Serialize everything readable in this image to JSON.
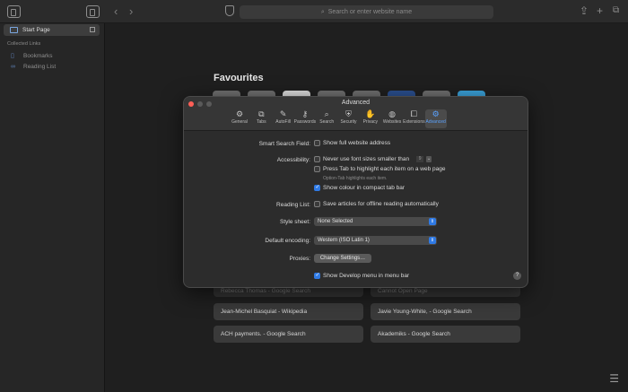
{
  "browser": {
    "address_placeholder": "Search or enter website name",
    "sidebar": {
      "start_page": "Start Page",
      "section": "Collected Links",
      "items": [
        {
          "label": "Bookmarks",
          "icon": "book-icon"
        },
        {
          "label": "Reading List",
          "icon": "glasses-icon"
        }
      ]
    }
  },
  "start_page": {
    "favourites_title": "Favourites",
    "tile_colors": [
      "#6e6e6e",
      "#6e6e6e",
      "#d9d9d9",
      "#6e6e6e",
      "#6e6e6e",
      "#2a4f8f",
      "#6e6e6e",
      "#3aa0d8"
    ],
    "cards": [
      {
        "label": "Rebecca Thomas - Google Search",
        "dim": true
      },
      {
        "label": "Cannot Open Page",
        "dim": true
      },
      {
        "label": "Jean-Michel Basquiat - Wikipedia",
        "dim": false
      },
      {
        "label": "Javie Young-White, - Google Search",
        "dim": false
      },
      {
        "label": "ACH payments. - Google Search",
        "dim": false
      },
      {
        "label": "Akademiks - Google Search",
        "dim": false
      }
    ]
  },
  "dialog": {
    "title": "Advanced",
    "tabs": [
      {
        "label": "General",
        "icon": "gear-icon"
      },
      {
        "label": "Tabs",
        "icon": "tabs-icon"
      },
      {
        "label": "AutoFill",
        "icon": "pencil-icon"
      },
      {
        "label": "Passwords",
        "icon": "key-icon"
      },
      {
        "label": "Search",
        "icon": "search-icon"
      },
      {
        "label": "Security",
        "icon": "lock-icon"
      },
      {
        "label": "Privacy",
        "icon": "hand-icon"
      },
      {
        "label": "Websites",
        "icon": "globe-icon"
      },
      {
        "label": "Extensions",
        "icon": "puzzle-icon"
      },
      {
        "label": "Advanced",
        "icon": "gears-icon"
      }
    ],
    "active_tab": "Advanced",
    "smart_search_label": "Smart Search Field:",
    "show_full_address": "Show full website address",
    "accessibility_label": "Accessibility:",
    "never_font_smaller": "Never use font sizes smaller than",
    "font_size_value": "9",
    "press_tab": "Press Tab to highlight each item on a web page",
    "option_tab_hint": "Option-Tab highlights each item.",
    "show_colour": "Show colour in compact tab bar",
    "reading_list_label": "Reading List:",
    "save_articles": "Save articles for offline reading automatically",
    "style_sheet_label": "Style sheet:",
    "style_sheet_value": "None Selected",
    "encoding_label": "Default encoding:",
    "encoding_value": "Western (ISO Latin 1)",
    "proxies_label": "Proxies:",
    "change_settings": "Change Settings…",
    "show_develop": "Show Develop menu in menu bar",
    "help": "?"
  }
}
